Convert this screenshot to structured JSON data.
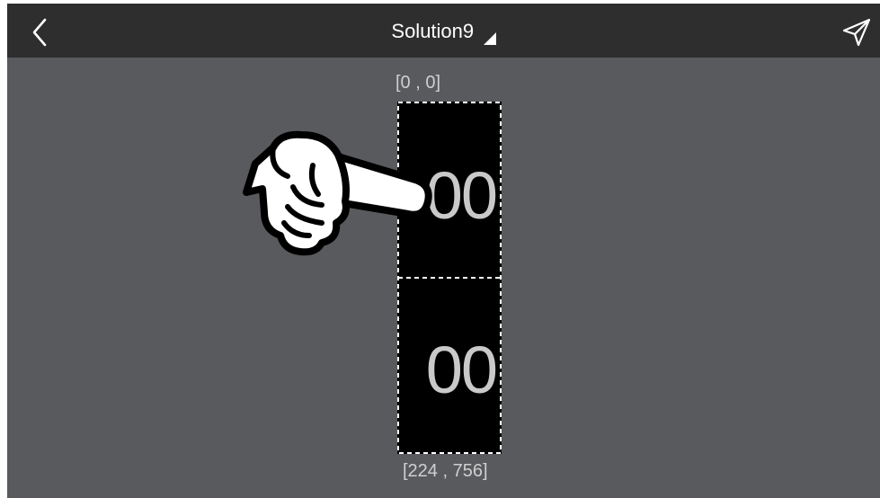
{
  "header": {
    "title": "Solution9",
    "back_icon": "chevron-left-icon",
    "dropdown_icon": "triangle-corner-icon",
    "send_icon": "send-paper-plane-icon"
  },
  "canvas": {
    "coord_start": "[0 , 0]",
    "coord_end": "[224 , 756]",
    "segments": [
      {
        "value": "00"
      },
      {
        "value": "00"
      }
    ],
    "pointer_icon": "hand-pointer-icon"
  },
  "colors": {
    "topbar": "#2e2e2e",
    "background": "#585a5d",
    "element": "#000000",
    "digits": "#c9c9c9"
  }
}
